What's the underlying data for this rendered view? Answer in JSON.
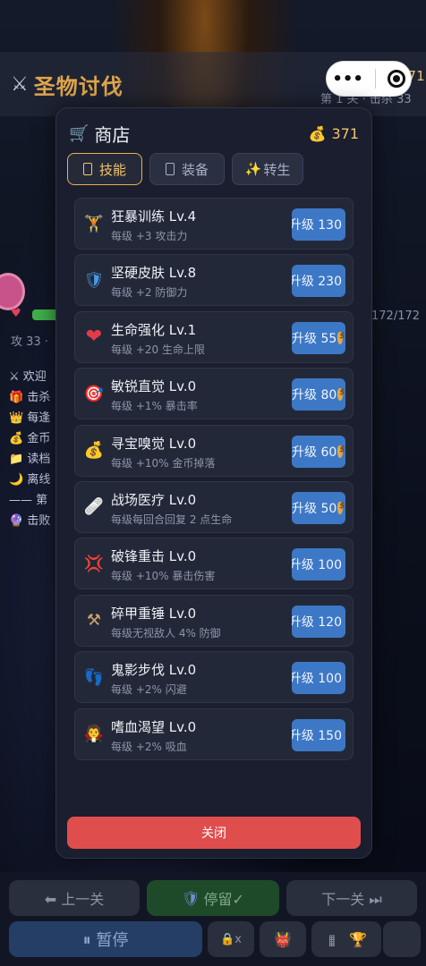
{
  "background": {
    "title": "圣物讨伐",
    "stage_text": "第 1 关 · 击杀 33",
    "gold_bg": "371",
    "hp_text": "172/172",
    "attack_text": "攻 33 ·",
    "log_lines": [
      "欢迎",
      "击杀",
      "每逢",
      "金币",
      "读档",
      "离线",
      "—— 第",
      "击败"
    ],
    "log_icons": [
      "⚔",
      "🎁",
      "👑",
      "💰",
      "📁",
      "🌙",
      "",
      "🔮"
    ]
  },
  "capsule": {
    "more": "•••"
  },
  "shop": {
    "title": "商店",
    "gold": "371",
    "tabs": [
      {
        "icon": "",
        "label": "技能"
      },
      {
        "icon": "",
        "label": "装备"
      },
      {
        "icon": "✨",
        "label": "转生"
      }
    ],
    "items": [
      {
        "icon": "🏋",
        "name": "狂暴训练",
        "level": "Lv.4",
        "desc": "每级 +3 攻击力",
        "button": "升级 130"
      },
      {
        "icon": "🛡",
        "name": "坚硬皮肤",
        "level": "Lv.8",
        "desc": "每级 +2 防御力",
        "button": "升级 230"
      },
      {
        "icon": "❤",
        "name": "生命强化",
        "level": "Lv.1",
        "desc": "每级 +20 生命上限",
        "button": "升级 55"
      },
      {
        "icon": "🎯",
        "name": "敏锐直觉",
        "level": "Lv.0",
        "desc": "每级 +1% 暴击率",
        "button": "升级 80"
      },
      {
        "icon": "💰",
        "name": "寻宝嗅觉",
        "level": "Lv.0",
        "desc": "每级 +10% 金币掉落",
        "button": "升级 60"
      },
      {
        "icon": "🩹",
        "name": "战场医疗",
        "level": "Lv.0",
        "desc": "每级每回合回复 2 点生命",
        "button": "升级 50"
      },
      {
        "icon": "💢",
        "name": "破锋重击",
        "level": "Lv.0",
        "desc": "每级 +10% 暴击伤害",
        "button": "升级 100"
      },
      {
        "icon": "⚒",
        "name": "碎甲重锤",
        "level": "Lv.0",
        "desc": "每级无视敌人 4% 防御",
        "button": "升级 120"
      },
      {
        "icon": "👣",
        "name": "鬼影步伐",
        "level": "Lv.0",
        "desc": "每级 +2% 闪避",
        "button": "升级 100"
      },
      {
        "icon": "🧛",
        "name": "嗜血渴望",
        "level": "Lv.0",
        "desc": "每级 +2% 吸血",
        "button": "升级 150"
      }
    ],
    "close_label": "关闭"
  },
  "bottom": {
    "prev": "⬅ 上一关",
    "stay": "停留✓",
    "next": "下一关 ⏭",
    "pause": "⏸ 暂停",
    "icons": [
      "🔒x",
      "👹",
      "▦",
      "🏆",
      ""
    ]
  },
  "colors": {
    "accent_gold": "#e8b24e",
    "button_blue": "#3d78c6",
    "close_red": "#e04d4d"
  }
}
